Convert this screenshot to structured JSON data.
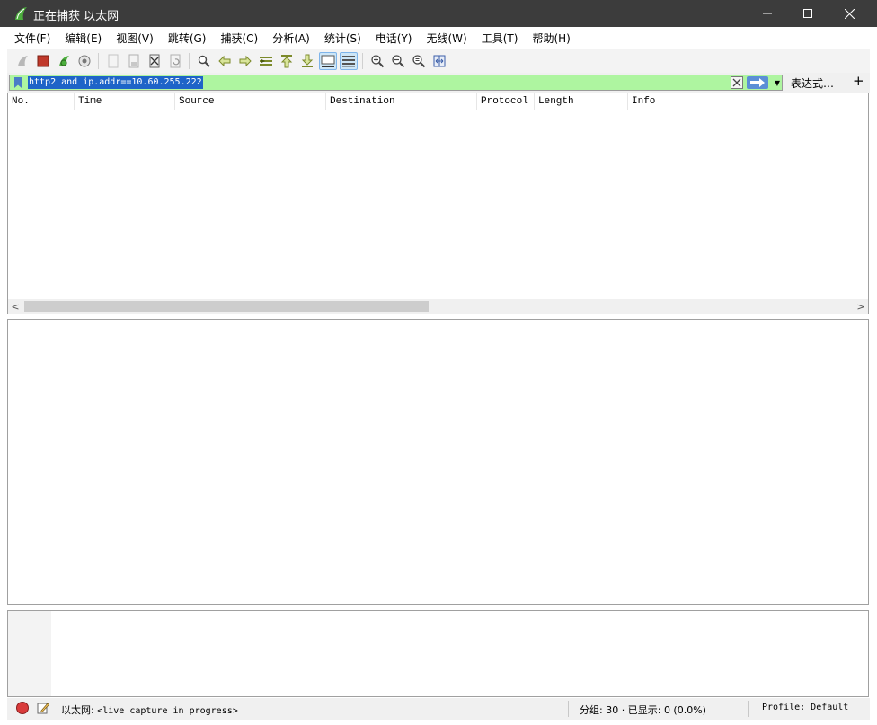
{
  "window": {
    "title": "正在捕获 以太网",
    "app_icon": "wireshark-fin-icon",
    "controls": {
      "minimize": "minimize-icon",
      "maximize": "maximize-icon",
      "close": "close-icon"
    }
  },
  "menu": [
    "文件(F)",
    "编辑(E)",
    "视图(V)",
    "跳转(G)",
    "捕获(C)",
    "分析(A)",
    "统计(S)",
    "电话(Y)",
    "无线(W)",
    "工具(T)",
    "帮助(H)"
  ],
  "toolbar": {
    "buttons": [
      {
        "icon": "start-capture-icon",
        "state": "disabled"
      },
      {
        "icon": "stop-capture-icon",
        "state": "enabled"
      },
      {
        "icon": "restart-capture-icon",
        "state": "enabled"
      },
      {
        "icon": "capture-options-icon",
        "state": "enabled"
      },
      {
        "icon": "open-file-icon",
        "state": "disabled"
      },
      {
        "icon": "save-file-icon",
        "state": "disabled"
      },
      {
        "icon": "close-file-icon",
        "state": "enabled"
      },
      {
        "icon": "reload-file-icon",
        "state": "disabled"
      },
      {
        "icon": "find-packet-icon",
        "state": "enabled"
      },
      {
        "icon": "go-back-icon",
        "state": "enabled"
      },
      {
        "icon": "go-forward-icon",
        "state": "enabled"
      },
      {
        "icon": "go-to-packet-icon",
        "state": "enabled"
      },
      {
        "icon": "first-packet-icon",
        "state": "enabled"
      },
      {
        "icon": "last-packet-icon",
        "state": "enabled"
      },
      {
        "icon": "auto-scroll-icon",
        "state": "active"
      },
      {
        "icon": "colorize-icon",
        "state": "active"
      },
      {
        "icon": "zoom-in-icon",
        "state": "enabled"
      },
      {
        "icon": "zoom-out-icon",
        "state": "enabled"
      },
      {
        "icon": "normal-size-icon",
        "state": "enabled"
      },
      {
        "icon": "resize-columns-icon",
        "state": "enabled"
      }
    ]
  },
  "filter": {
    "value": "http2 and ip.addr==10.60.255.222",
    "background": "#aef5a0",
    "expression_label": "表达式…",
    "add_label": "+"
  },
  "packet_list": {
    "columns": [
      "No.",
      "Time",
      "Source",
      "Destination",
      "Protocol",
      "Length",
      "Info"
    ],
    "rows": []
  },
  "status": {
    "interface_label": "以太网:",
    "capture_state": "<live capture in progress>",
    "packets_label": "分组:",
    "packets_count": "30",
    "separator": "·",
    "displayed_label": "已显示:",
    "displayed_value": "0 (0.0%)",
    "profile": "Profile: Default"
  }
}
